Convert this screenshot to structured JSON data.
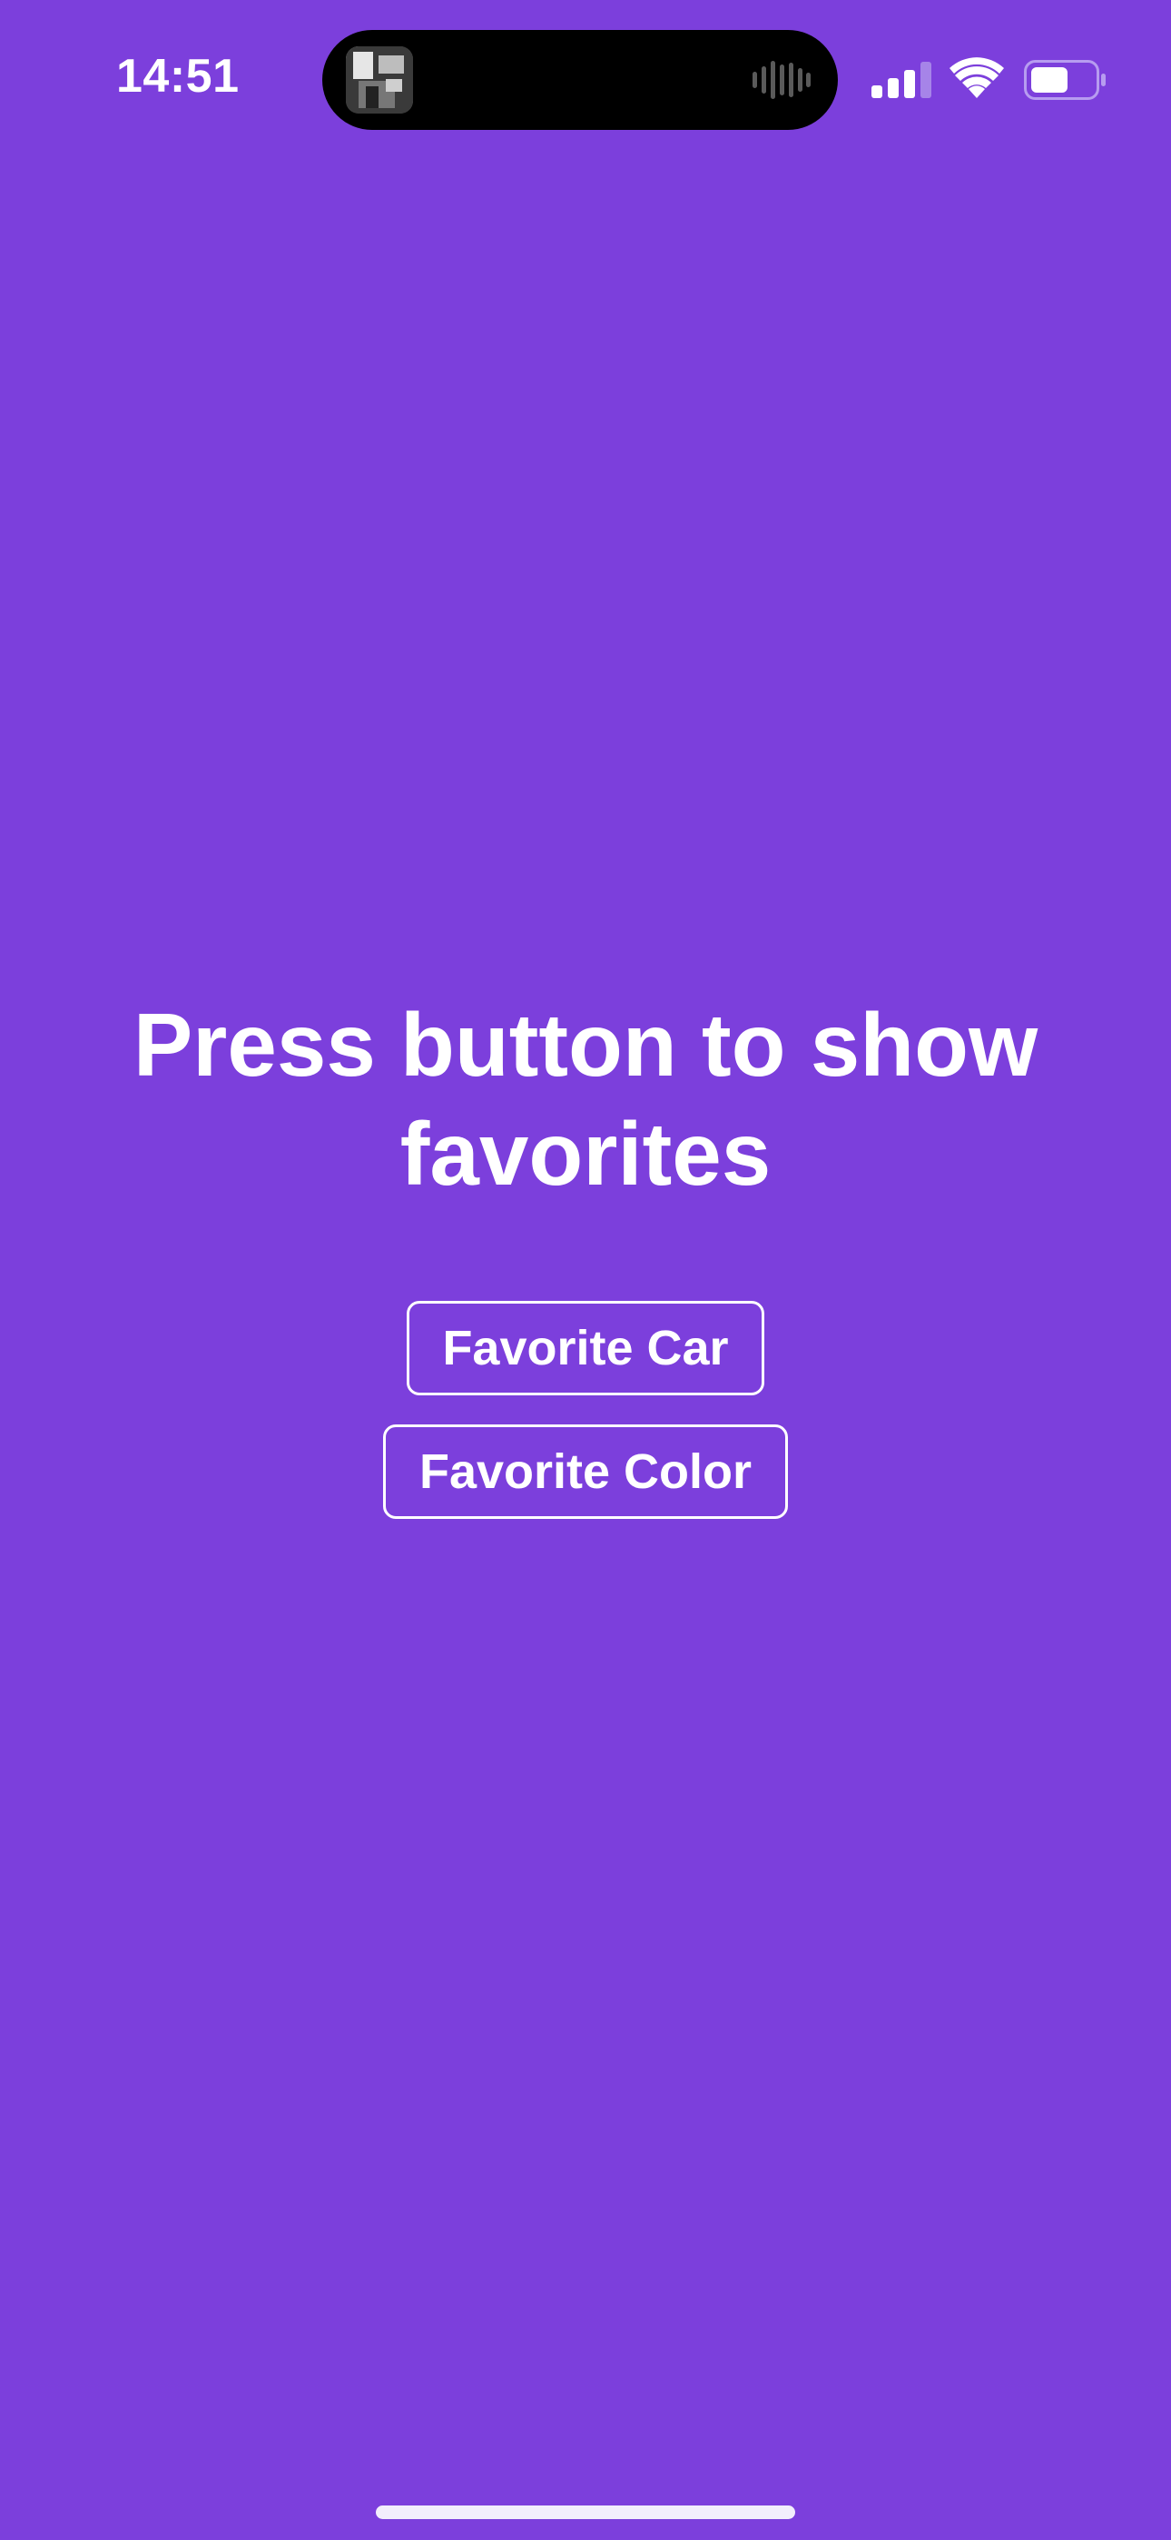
{
  "status_bar": {
    "time": "14:51",
    "icons": [
      "album-art-icon",
      "audio-waveform-icon",
      "cellular-signal-icon",
      "wifi-icon",
      "battery-icon"
    ]
  },
  "main": {
    "headline": "Press button to show favorites",
    "buttons": [
      {
        "label": "Favorite Car"
      },
      {
        "label": "Favorite Color"
      }
    ]
  },
  "colors": {
    "background": "#7c3fdc",
    "foreground": "#ffffff",
    "island": "#000000"
  }
}
